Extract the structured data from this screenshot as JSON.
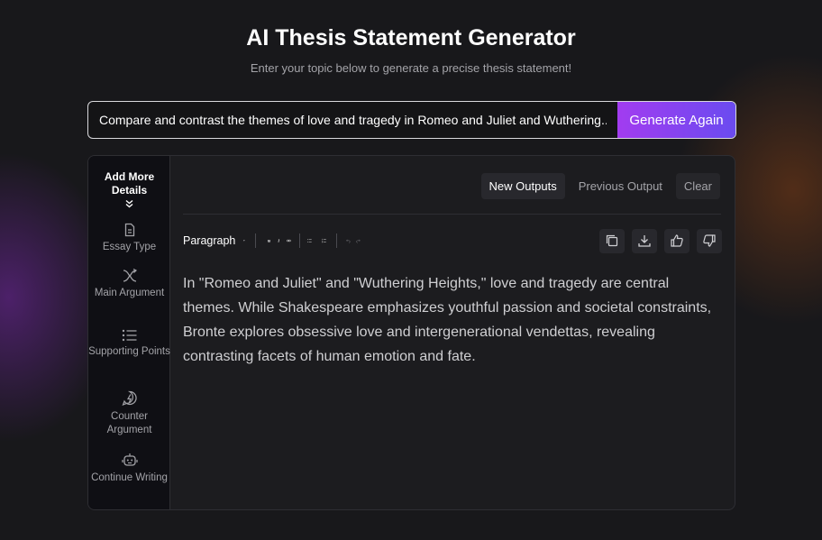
{
  "header": {
    "title": "AI Thesis Statement Generator",
    "subtitle": "Enter your topic below to generate a precise thesis statement!"
  },
  "search": {
    "value": "Compare and contrast the themes of love and tragedy in Romeo and Juliet and Wuthering...",
    "button_label": "Generate Again"
  },
  "sidebar": {
    "heading": "Add More Details",
    "items": [
      {
        "label": "Essay Type",
        "icon": "document-icon"
      },
      {
        "label": "Main Argument",
        "icon": "split-arrows-icon"
      },
      {
        "label": "Supporting Points",
        "icon": "list-icon"
      },
      {
        "label": "Counter Argument",
        "icon": "lightning-bubble-icon"
      },
      {
        "label": "Continue Writing",
        "icon": "robot-icon"
      }
    ]
  },
  "tabs": [
    {
      "label": "New Outputs",
      "active": true
    },
    {
      "label": "Previous Output",
      "active": false
    },
    {
      "label": "Clear",
      "active": false
    }
  ],
  "toolbar": {
    "block_format": "Paragraph",
    "format_icons": [
      "bold-icon",
      "italic-icon",
      "link-icon",
      "bullet-list-icon",
      "numbered-list-icon",
      "undo-icon",
      "redo-icon"
    ],
    "action_icons": [
      "copy-icon",
      "download-icon",
      "thumbs-up-icon",
      "thumbs-down-icon"
    ]
  },
  "output": {
    "text": "In \"Romeo and Juliet\" and \"Wuthering Heights,\" love and tragedy are central themes. While Shakespeare emphasizes youthful passion and societal constraints, Bronte explores obsessive love and intergenerational vendettas, revealing contrasting facets of human emotion and fate."
  },
  "colors": {
    "accent_start": "#a23cf0",
    "accent_end": "#6a4bf0",
    "background": "#18181b",
    "panel": "#1c1c1f"
  }
}
